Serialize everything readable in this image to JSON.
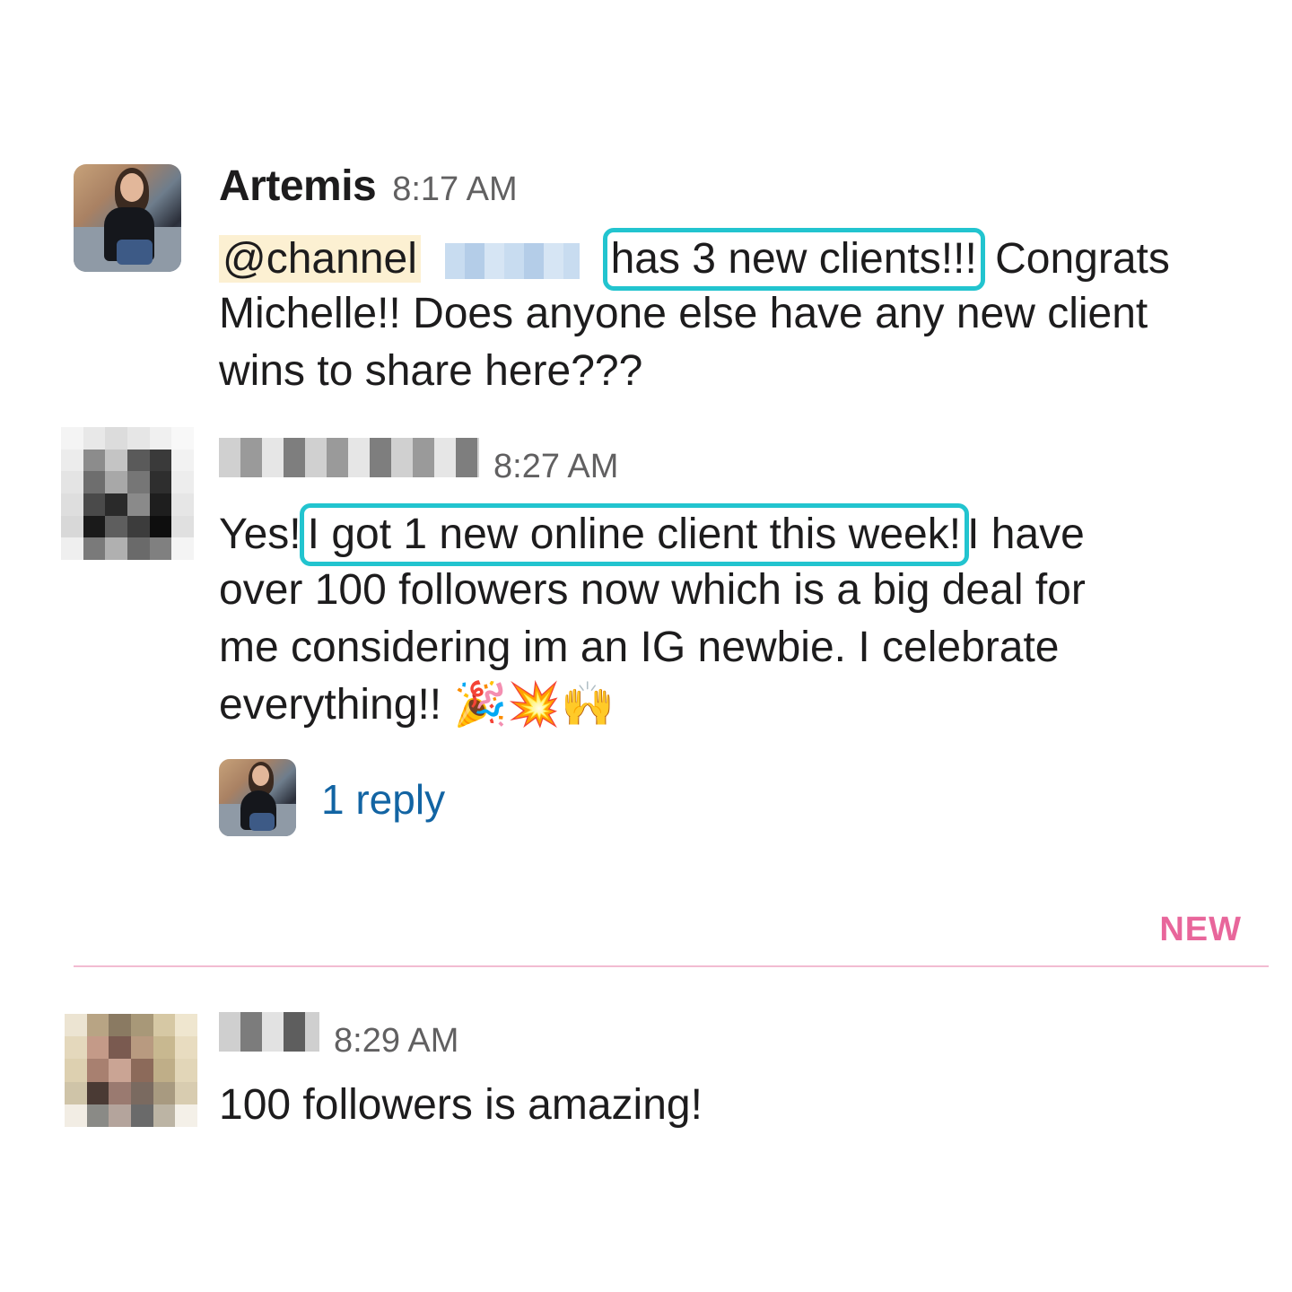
{
  "messages": [
    {
      "author": "Artemis",
      "time": "8:17 AM",
      "mention": "@channel",
      "highlight": "has 3 new clients!!!",
      "after_highlight": " Congrats",
      "line2": "Michelle!! Does anyone else have any new client",
      "line3": "wins to share here???"
    },
    {
      "author": "",
      "time": "8:27 AM",
      "before_highlight": "Yes!",
      "highlight": "I got 1 new online client this week!",
      "after_highlight": "I have",
      "line2": "over 100 followers now which is a big deal for",
      "line3": "me considering im an IG newbie. I celebrate",
      "line4": "everything!! 🎉💥🙌",
      "reply_count_label": "1 reply"
    },
    {
      "author": "",
      "time": "8:29 AM",
      "text": "100 followers is amazing!"
    }
  ],
  "divider": {
    "label": "NEW"
  },
  "colors": {
    "highlight_border": "#22c4cf",
    "mention_bg": "#fcf0d2",
    "link": "#1264a3",
    "new_divider": "#e8669b"
  }
}
